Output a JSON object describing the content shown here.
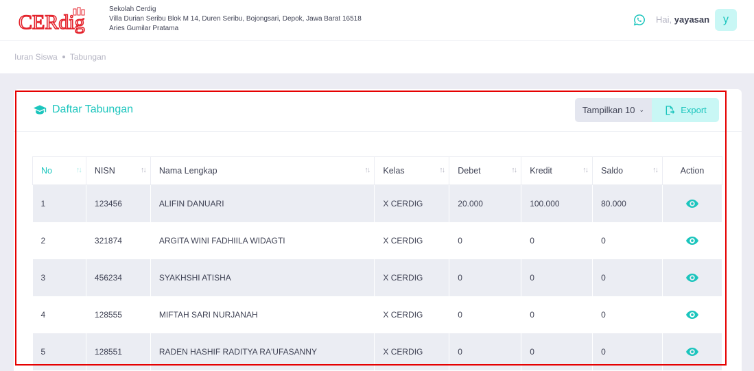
{
  "header": {
    "logo_text": "CERdig",
    "school_name": "Sekolah Cerdig",
    "school_address": "Villa Durian Seribu Blok M 14, Duren Seribu, Bojongsari, Depok, Jawa Barat 16518",
    "school_contact": "Aries Gumilar Pratama",
    "greeting_prefix": "Hai,",
    "username": "yayasan",
    "avatar_initial": "y"
  },
  "breadcrumb": [
    "Iuran Siswa",
    "Tabungan"
  ],
  "card": {
    "title": "Daftar Tabungan",
    "show_label": "Tampilkan 10",
    "export_label": "Export"
  },
  "table": {
    "columns": [
      "No",
      "NISN",
      "Nama Lengkap",
      "Kelas",
      "Debet",
      "Kredit",
      "Saldo",
      "Action"
    ],
    "rows": [
      {
        "no": "1",
        "nisn": "123456",
        "nama": "ALIFIN DANUARI",
        "kelas": "X CERDIG",
        "debet": "20.000",
        "kredit": "100.000",
        "saldo": "80.000"
      },
      {
        "no": "2",
        "nisn": "321874",
        "nama": "ARGITA WINI FADHIILA WIDAGTI",
        "kelas": "X CERDIG",
        "debet": "0",
        "kredit": "0",
        "saldo": "0"
      },
      {
        "no": "3",
        "nisn": "456234",
        "nama": "SYAKHSHI ATISHA",
        "kelas": "X CERDIG",
        "debet": "0",
        "kredit": "0",
        "saldo": "0"
      },
      {
        "no": "4",
        "nisn": "128555",
        "nama": "MIFTAH SARI NURJANAH",
        "kelas": "X CERDIG",
        "debet": "0",
        "kredit": "0",
        "saldo": "0"
      },
      {
        "no": "5",
        "nisn": "128551",
        "nama": "RADEN HASHIF RADITYA RA'UFASANNY",
        "kelas": "X CERDIG",
        "debet": "0",
        "kredit": "0",
        "saldo": "0"
      }
    ]
  },
  "colors": {
    "accent": "#1bc5bd",
    "accent_light": "#c9f7f5",
    "logo_red": "#e4222b",
    "highlight": "#e60000"
  },
  "icons": [
    "logo",
    "whatsapp-icon",
    "graduation-cap-icon",
    "chevron-down-icon",
    "export-file-icon",
    "sort-icon",
    "eye-icon"
  ]
}
